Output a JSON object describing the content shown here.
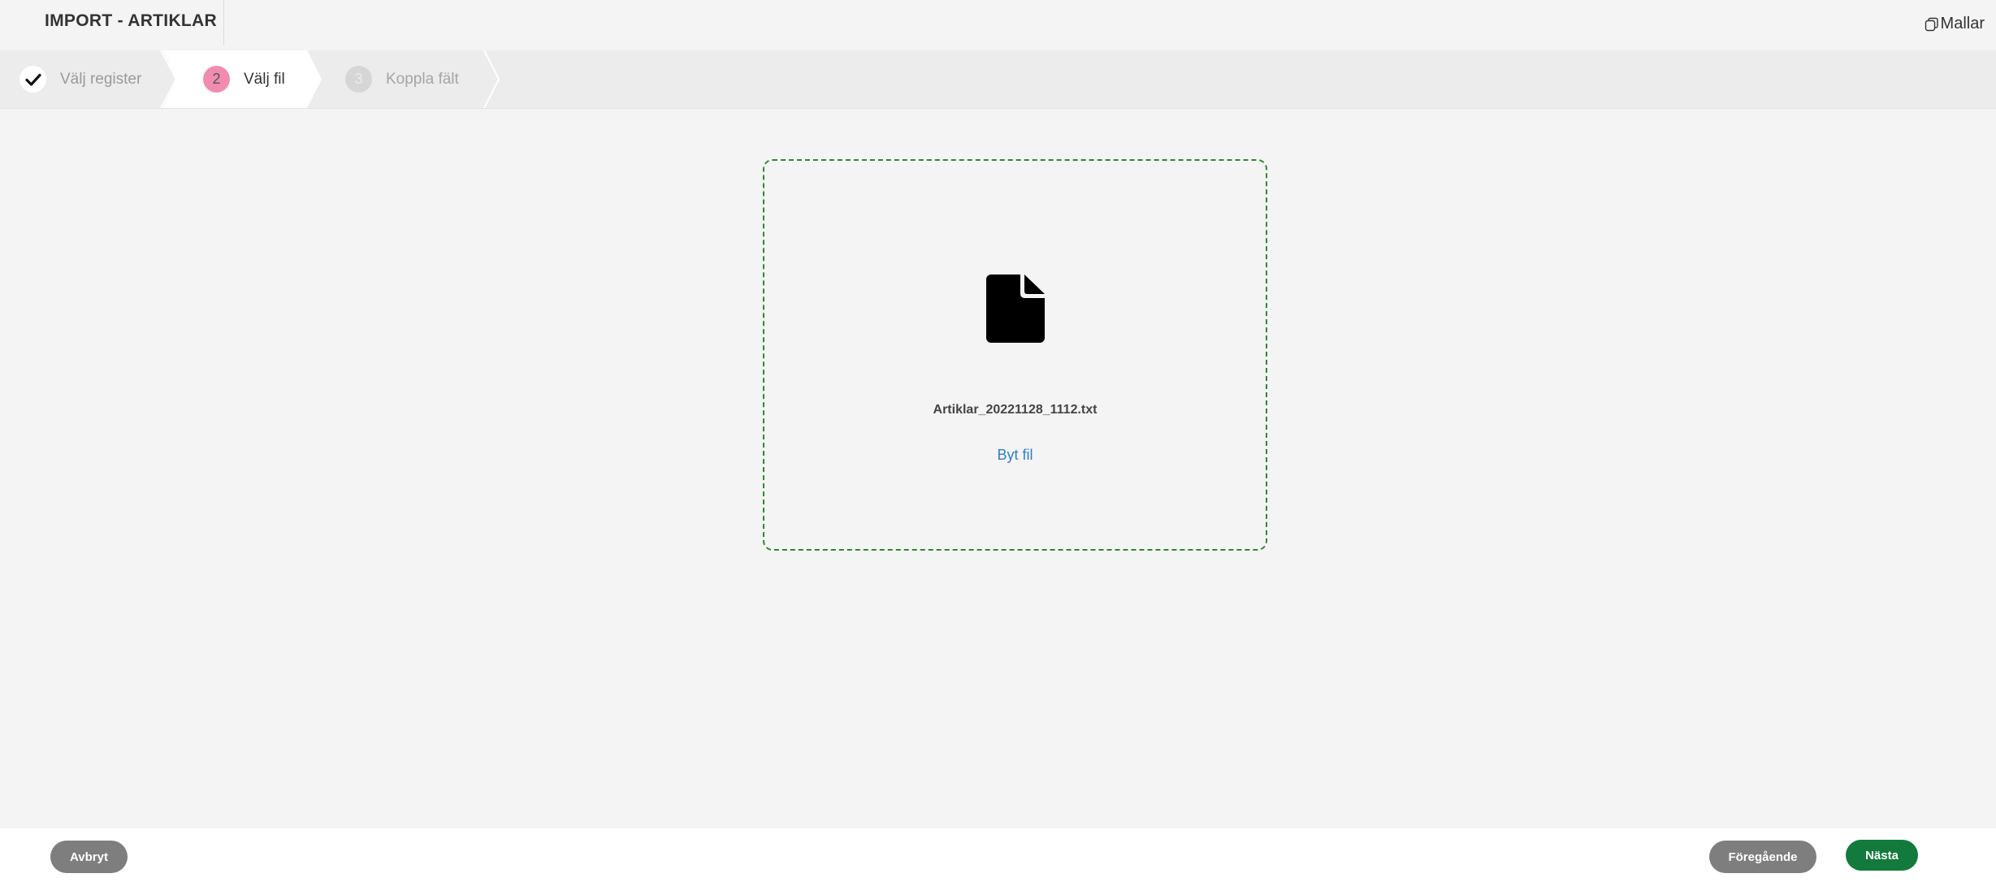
{
  "header": {
    "title": "IMPORT - ARTIKLAR",
    "templates_label": "Mallar"
  },
  "stepper": {
    "steps": [
      {
        "number": "1",
        "label": "Välj register",
        "state": "completed"
      },
      {
        "number": "2",
        "label": "Välj fil",
        "state": "active"
      },
      {
        "number": "3",
        "label": "Koppla fält",
        "state": "inactive"
      }
    ]
  },
  "dropzone": {
    "file_name": "Artiklar_20221128_1112.txt",
    "change_file_label": "Byt fil",
    "border_color": "#2e8b2e"
  },
  "footer": {
    "cancel_label": "Avbryt",
    "previous_label": "Föregående",
    "next_label": "Nästa"
  },
  "colors": {
    "accent_pink": "#f18cb0",
    "primary_green": "#127a3c",
    "link_blue": "#2f7fc8",
    "secondary_gray": "#7e7e7e"
  },
  "icons": {
    "completed_step": "check-icon",
    "file": "file-icon",
    "templates": "copy-icon"
  }
}
